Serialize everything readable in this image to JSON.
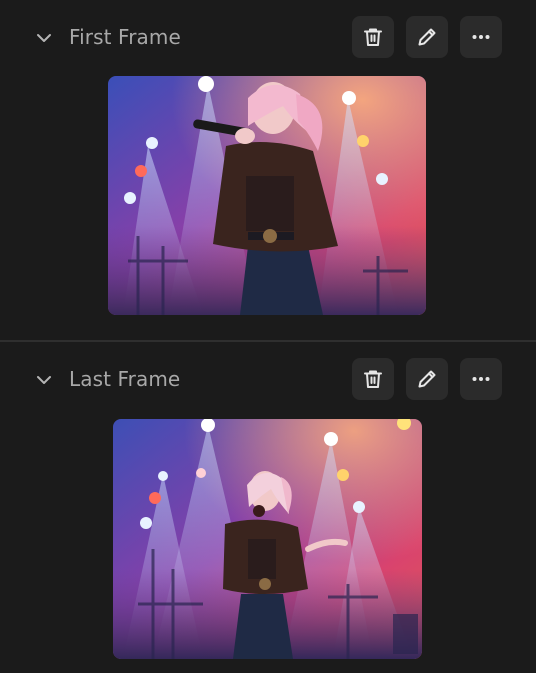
{
  "frames": [
    {
      "title": "First Frame",
      "image_alt": "Singer with microphone on stage under pink and blue spotlights",
      "actions": [
        "delete",
        "edit",
        "more"
      ]
    },
    {
      "title": "Last Frame",
      "image_alt": "Singer with microphone on stage, wider shot under pink and blue spotlights",
      "actions": [
        "delete",
        "edit",
        "more"
      ]
    }
  ],
  "icons": {
    "collapse": "chevron-down-icon",
    "delete": "trash-icon",
    "edit": "pencil-icon",
    "more": "ellipsis-icon"
  },
  "colors": {
    "background": "#1b1b1b",
    "button_bg": "#2b2b2b",
    "divider": "#2f2f2f",
    "text": "#a8a8a8",
    "icon": "#e6e6e6"
  }
}
